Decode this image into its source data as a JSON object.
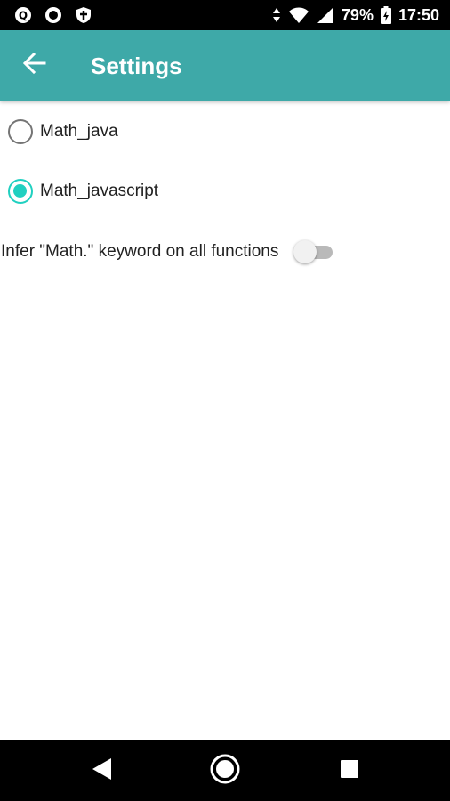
{
  "status_bar": {
    "battery": "79%",
    "time": "17:50",
    "left_icons": [
      "assistant-icon",
      "record-icon",
      "shield-icon"
    ],
    "right_icons": [
      "data-arrows-icon",
      "wifi-icon",
      "signal-icon",
      "battery-charging-icon"
    ]
  },
  "app_bar": {
    "title": "Settings",
    "color": "#3ea9a8",
    "back_icon": "arrow-back-icon"
  },
  "options": [
    {
      "label": "Math_java",
      "selected": false
    },
    {
      "label": "Math_javascript",
      "selected": true
    }
  ],
  "infer_toggle": {
    "label": "Infer \"Math.\" keyword on all functions",
    "enabled": false
  },
  "accent_color": "#20d0c0",
  "nav_bar": {
    "buttons": [
      "back-triangle-icon",
      "home-circle-icon",
      "recents-square-icon"
    ]
  }
}
